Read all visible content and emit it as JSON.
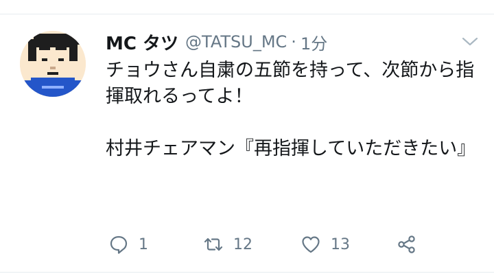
{
  "tweet": {
    "display_name": "MC タツ",
    "handle": "@TATSU_MC",
    "separator": "·",
    "time": "1分",
    "text_para1": "チョウさん自粛の五節を持って、次節から指揮取れるってよ！",
    "text_para2": "村井チェアマン『再指揮していただきたい』"
  },
  "actions": {
    "reply_count": "1",
    "retweet_count": "12",
    "like_count": "13"
  },
  "icons": {
    "menu": "chevron-down-icon",
    "reply": "reply-icon",
    "retweet": "retweet-icon",
    "like": "heart-icon",
    "share": "share-icon"
  },
  "colors": {
    "text": "#14171a",
    "secondary": "#657786",
    "avatar_shirt": "#2456c9"
  }
}
